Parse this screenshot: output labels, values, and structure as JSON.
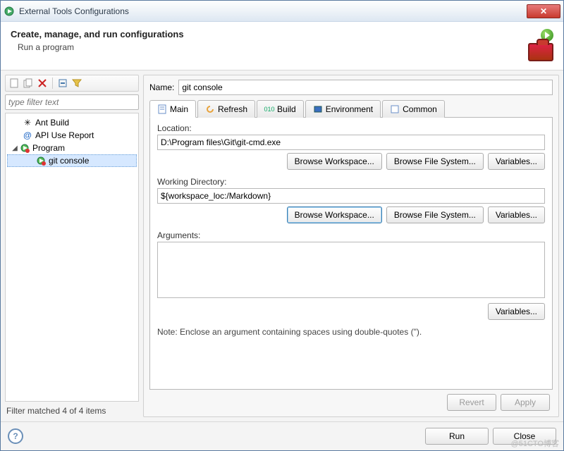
{
  "window": {
    "title": "External Tools Configurations"
  },
  "header": {
    "title": "Create, manage, and run configurations",
    "subtitle": "Run a program"
  },
  "left": {
    "filter_placeholder": "type filter text",
    "tree": {
      "ant": "Ant Build",
      "api": "API Use Report",
      "program": "Program",
      "gitconsole": "git console"
    },
    "status": "Filter matched 4 of 4 items"
  },
  "form": {
    "name_label": "Name:",
    "name_value": "git console",
    "tabs": {
      "main": "Main",
      "refresh": "Refresh",
      "build": "Build",
      "environment": "Environment",
      "common": "Common"
    },
    "location_label": "Location:",
    "location_value": "D:\\Program files\\Git\\git-cmd.exe",
    "workdir_label": "Working Directory:",
    "workdir_value": "${workspace_loc:/Markdown}",
    "args_label": "Arguments:",
    "args_value": "",
    "note": "Note: Enclose an argument containing spaces using double-quotes (\").",
    "buttons": {
      "browse_ws": "Browse Workspace...",
      "browse_fs": "Browse File System...",
      "variables": "Variables...",
      "revert": "Revert",
      "apply": "Apply",
      "run": "Run",
      "close": "Close"
    }
  },
  "watermark": "@51CTO博客"
}
